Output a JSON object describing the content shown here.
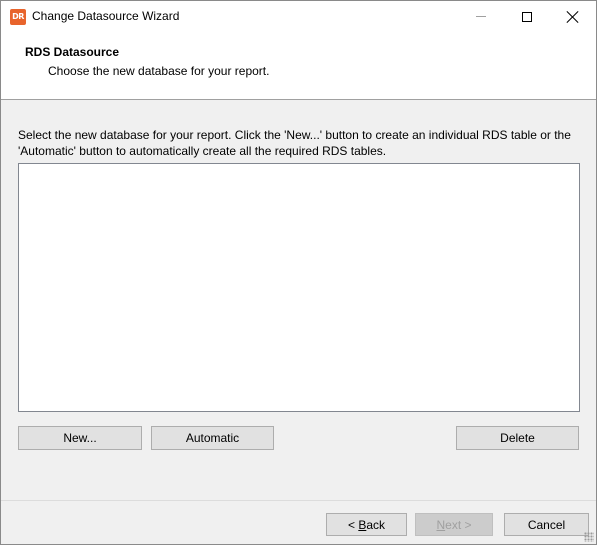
{
  "window": {
    "title": "Change Datasource Wizard",
    "app_icon_text": "DR",
    "accent_color": "#e8642c"
  },
  "header": {
    "title": "RDS Datasource",
    "subtitle": "Choose the new database for your report."
  },
  "main": {
    "instructions": "Select the new database for your report. Click the 'New...' button to create an individual RDS table or the 'Automatic' button to automatically create all the required RDS tables.",
    "database_list": []
  },
  "buttons": {
    "new_label": "New...",
    "automatic_label": "Automatic",
    "delete_label": "Delete"
  },
  "footer": {
    "back_prefix": "< ",
    "back_mnemonic": "B",
    "back_rest": "ack",
    "next_prefix": "",
    "next_mnemonic": "N",
    "next_rest": "ext >",
    "next_enabled": false,
    "cancel_label": "Cancel"
  }
}
